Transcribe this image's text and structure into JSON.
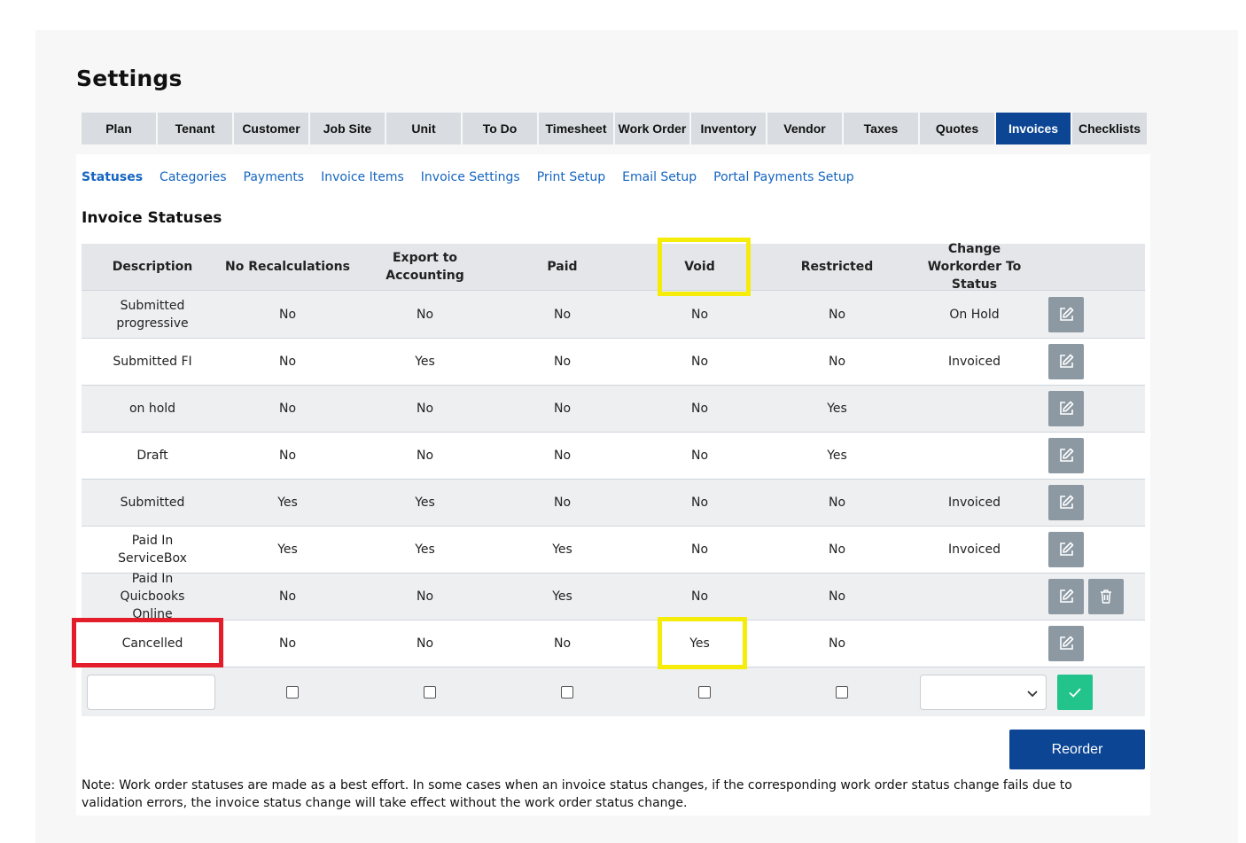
{
  "page_title": "Settings",
  "tabs": [
    {
      "label": "Plan",
      "active": false
    },
    {
      "label": "Tenant",
      "active": false
    },
    {
      "label": "Customer",
      "active": false
    },
    {
      "label": "Job Site",
      "active": false
    },
    {
      "label": "Unit",
      "active": false
    },
    {
      "label": "To Do",
      "active": false
    },
    {
      "label": "Timesheet",
      "active": false
    },
    {
      "label": "Work Order",
      "active": false
    },
    {
      "label": "Inventory",
      "active": false
    },
    {
      "label": "Vendor",
      "active": false
    },
    {
      "label": "Taxes",
      "active": false
    },
    {
      "label": "Quotes",
      "active": false
    },
    {
      "label": "Invoices",
      "active": true
    },
    {
      "label": "Checklists",
      "active": false
    }
  ],
  "subnav": [
    {
      "label": "Statuses",
      "active": true
    },
    {
      "label": "Categories",
      "active": false
    },
    {
      "label": "Payments",
      "active": false
    },
    {
      "label": "Invoice Items",
      "active": false
    },
    {
      "label": "Invoice Settings",
      "active": false
    },
    {
      "label": "Print Setup",
      "active": false
    },
    {
      "label": "Email Setup",
      "active": false
    },
    {
      "label": "Portal Payments Setup",
      "active": false
    }
  ],
  "section_title": "Invoice Statuses",
  "table": {
    "headers": [
      "Description",
      "No Recalculations",
      "Export to Accounting",
      "Paid",
      "Void",
      "Restricted",
      "Change Workorder To Status"
    ],
    "rows": [
      {
        "description": "Submitted progressive",
        "no_recalc": "No",
        "export": "No",
        "paid": "No",
        "void": "No",
        "restricted": "No",
        "change_to": "On Hold",
        "deletable": false
      },
      {
        "description": "Submitted FI",
        "no_recalc": "No",
        "export": "Yes",
        "paid": "No",
        "void": "No",
        "restricted": "No",
        "change_to": "Invoiced",
        "deletable": false
      },
      {
        "description": "on hold",
        "no_recalc": "No",
        "export": "No",
        "paid": "No",
        "void": "No",
        "restricted": "Yes",
        "change_to": "",
        "deletable": false
      },
      {
        "description": "Draft",
        "no_recalc": "No",
        "export": "No",
        "paid": "No",
        "void": "No",
        "restricted": "Yes",
        "change_to": "",
        "deletable": false
      },
      {
        "description": "Submitted",
        "no_recalc": "Yes",
        "export": "Yes",
        "paid": "No",
        "void": "No",
        "restricted": "No",
        "change_to": "Invoiced",
        "deletable": false
      },
      {
        "description": "Paid In ServiceBox",
        "no_recalc": "Yes",
        "export": "Yes",
        "paid": "Yes",
        "void": "No",
        "restricted": "No",
        "change_to": "Invoiced",
        "deletable": false
      },
      {
        "description": "Paid In Quicbooks Online",
        "no_recalc": "No",
        "export": "No",
        "paid": "Yes",
        "void": "No",
        "restricted": "No",
        "change_to": "",
        "deletable": true
      },
      {
        "description": "Cancelled",
        "no_recalc": "No",
        "export": "No",
        "paid": "No",
        "void": "Yes",
        "restricted": "No",
        "change_to": "",
        "deletable": false
      }
    ],
    "new_row": {
      "description_value": "",
      "select_value": ""
    }
  },
  "reorder_label": "Reorder",
  "note": "Note: Work order statuses are made as a best effort. In some cases when an invoice status changes, if the corresponding work order status change fails due to validation errors, the invoice status change will take effect without the work order status change.",
  "icons": {
    "edit": "edit-icon",
    "delete": "trash-icon",
    "confirm": "check-icon",
    "dropdown": "chevron-down-icon"
  },
  "colors": {
    "brand": "#0b4594",
    "link": "#1565c0",
    "edit_button": "#8c99a3",
    "confirm_button": "#23c38c",
    "highlight_yellow": "#f5ec0a",
    "highlight_red": "#e41d2a"
  }
}
